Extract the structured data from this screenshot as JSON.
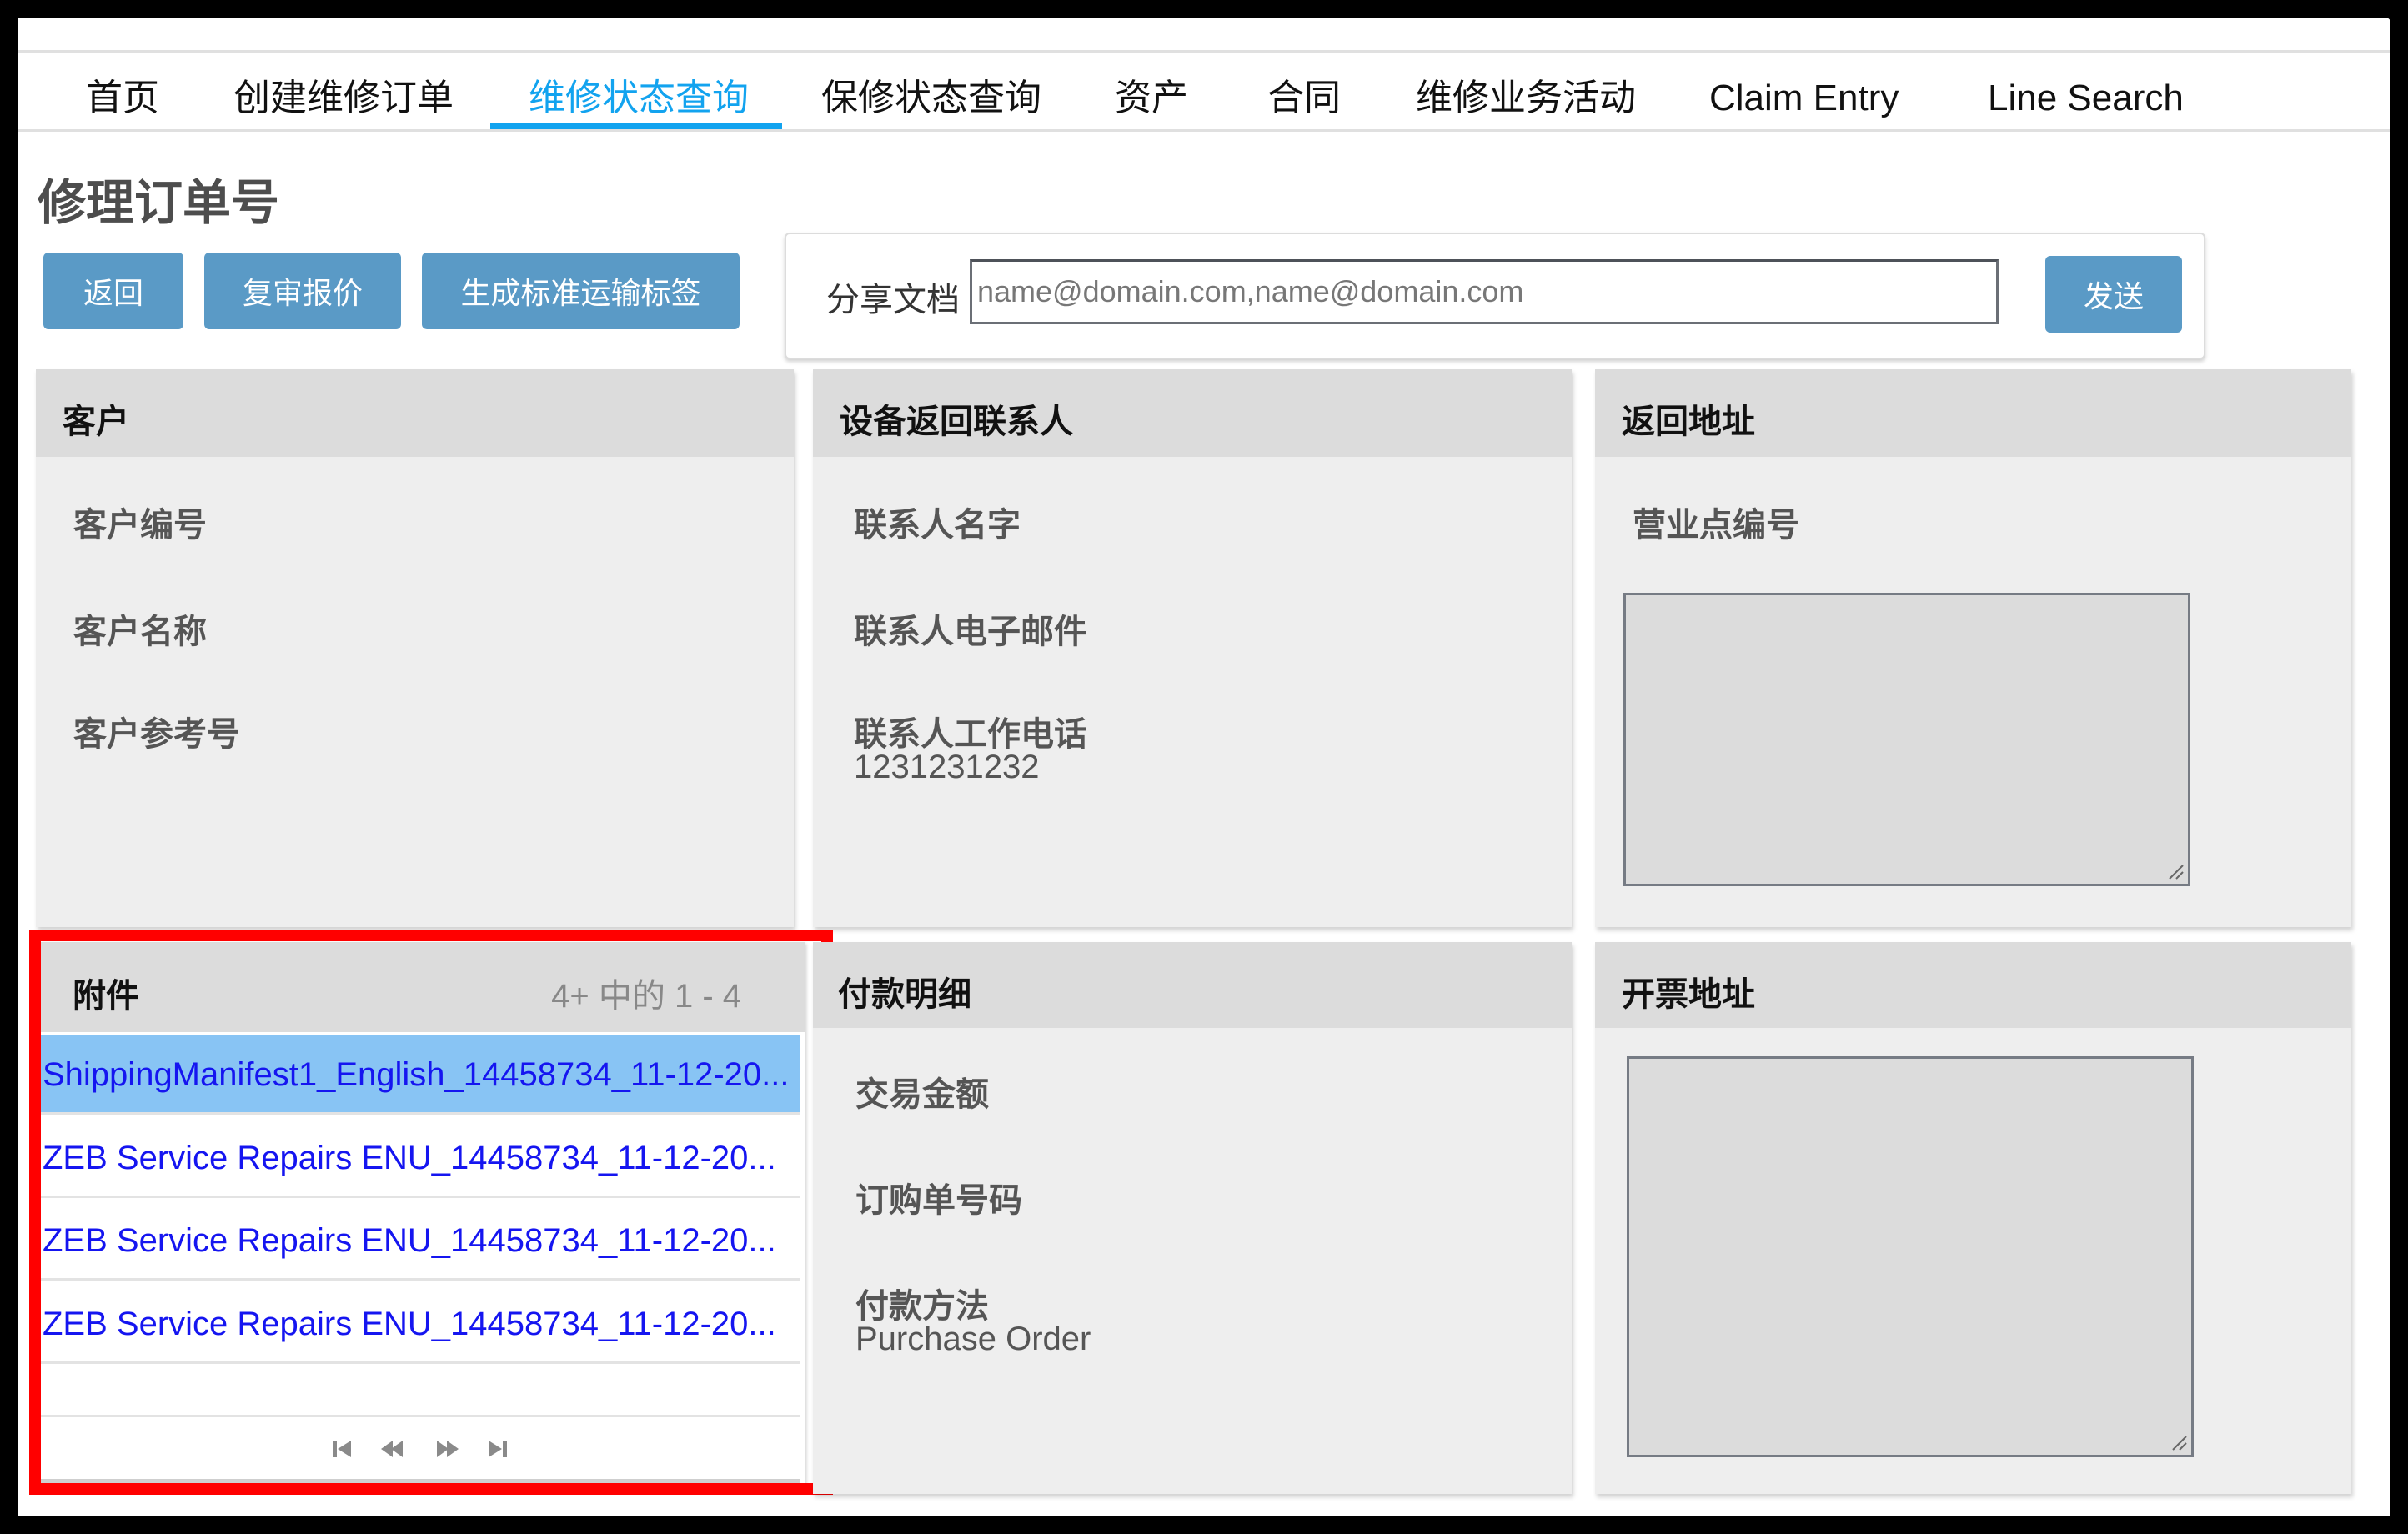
{
  "nav": {
    "items": [
      {
        "label": "首页",
        "active": false
      },
      {
        "label": "创建维修订单",
        "active": false
      },
      {
        "label": "维修状态查询",
        "active": true
      },
      {
        "label": "保修状态查询",
        "active": false
      },
      {
        "label": "资产",
        "active": false
      },
      {
        "label": "合同",
        "active": false
      },
      {
        "label": "维修业务活动",
        "active": false
      },
      {
        "label": "Claim Entry",
        "active": false
      },
      {
        "label": "Line Search",
        "active": false
      }
    ],
    "active_color": "#12a3ef"
  },
  "page": {
    "title": "修理订单号"
  },
  "toolbar": {
    "back_label": "返回",
    "review_quote_label": "复审报价",
    "generate_label_label": "生成标准运输标签",
    "button_color": "#5a9ac6"
  },
  "share": {
    "label": "分享文档",
    "placeholder": "name@domain.com,name@domain.com",
    "value": "",
    "send_label": "发送"
  },
  "customer": {
    "title": "客户",
    "fields": [
      {
        "label": "客户编号",
        "value": ""
      },
      {
        "label": "客户名称",
        "value": ""
      },
      {
        "label": "客户参考号",
        "value": ""
      }
    ]
  },
  "contact": {
    "title": "设备返回联系人",
    "fields": [
      {
        "label": "联系人名字",
        "value": ""
      },
      {
        "label": "联系人电子邮件",
        "value": ""
      },
      {
        "label": "联系人工作电话",
        "value": "1231231232"
      }
    ]
  },
  "return_address": {
    "title": "返回地址",
    "site_label": "营业点编号",
    "site_value": "",
    "address_value": ""
  },
  "attachments": {
    "title": "附件",
    "count_text": "4+ 中的 1 - 4",
    "items": [
      {
        "name": "ShippingManifest1_English_14458734_11-12-20...",
        "selected": true
      },
      {
        "name": "ZEB Service Repairs ENU_14458734_11-12-20...",
        "selected": false
      },
      {
        "name": "ZEB Service Repairs ENU_14458734_11-12-20...",
        "selected": false
      },
      {
        "name": "ZEB Service Repairs ENU_14458734_11-12-20...",
        "selected": false
      }
    ],
    "pager": [
      "first-page-icon",
      "previous-page-icon",
      "next-page-icon",
      "last-page-icon"
    ],
    "highlight_color": "#ff0000"
  },
  "payment": {
    "title": "付款明细",
    "fields": [
      {
        "label": "交易金额",
        "value": ""
      },
      {
        "label": "订购单号码",
        "value": ""
      },
      {
        "label": "付款方法",
        "value": "Purchase Order"
      }
    ]
  },
  "billing_address": {
    "title": "开票地址",
    "address_value": ""
  }
}
